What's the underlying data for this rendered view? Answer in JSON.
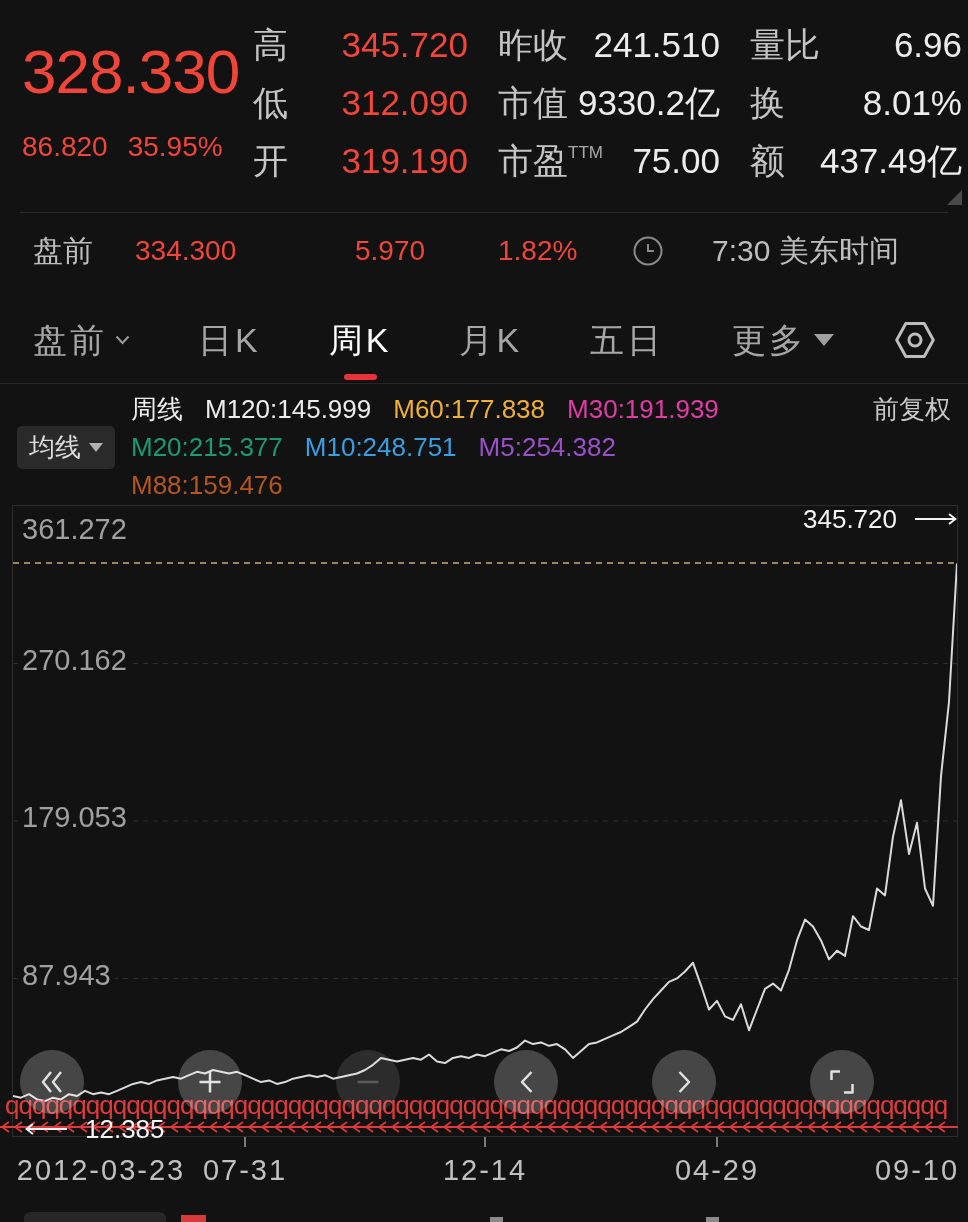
{
  "quote": {
    "price": "328.330",
    "change": "86.820",
    "change_pct": "35.95%",
    "up": true
  },
  "stats": [
    [
      {
        "label": "高",
        "value": "345.720",
        "up": true
      },
      {
        "label": "低",
        "value": "312.090",
        "up": true
      },
      {
        "label": "开",
        "value": "319.190",
        "up": true
      }
    ],
    [
      {
        "label": "昨收",
        "value": "241.510",
        "up": false
      },
      {
        "label": "市值",
        "value": "9330.2亿",
        "up": false
      },
      {
        "label": "市盈$^{TTM}$",
        "value": "75.00",
        "up": false
      }
    ],
    [
      {
        "label": "量比",
        "value": "6.96",
        "up": false
      },
      {
        "label": "换",
        "value": "8.01%",
        "up": false
      },
      {
        "label": "额",
        "value": "437.49亿",
        "up": false
      }
    ]
  ],
  "premarket": {
    "label": "盘前",
    "price": "334.300",
    "change": "5.970",
    "change_pct": "1.82%",
    "up": true,
    "time": "7:30 美东时间"
  },
  "tabs": [
    {
      "label": "盘前",
      "kind": "chevron",
      "selected": false
    },
    {
      "label": "日K",
      "kind": "plain",
      "selected": false
    },
    {
      "label": "周K",
      "kind": "plain",
      "selected": true
    },
    {
      "label": "月K",
      "kind": "plain",
      "selected": false
    },
    {
      "label": "五日",
      "kind": "plain",
      "selected": false
    },
    {
      "label": "更多",
      "kind": "triangle",
      "selected": false
    }
  ],
  "legend": {
    "dropdown": "均线",
    "adjustment": "前复权",
    "rows": [
      [
        {
          "kind": "title",
          "text": "周线"
        },
        {
          "kind": "ma",
          "text": "M120:145.999",
          "color": "#ececec"
        },
        {
          "kind": "ma",
          "text": "M60:177.838",
          "color": "#f0b034"
        },
        {
          "kind": "ma",
          "text": "M30:191.939",
          "color": "#e03ca4"
        }
      ],
      [
        {
          "kind": "ma",
          "text": "M20:215.377",
          "color": "#1c9a70"
        },
        {
          "kind": "ma",
          "text": "M10:248.751",
          "color": "#3a9ee2"
        },
        {
          "kind": "ma",
          "text": "M5:254.382",
          "color": "#9a50c8"
        }
      ],
      [
        {
          "kind": "ma",
          "text": "M88:159.476",
          "color": "#b4561e"
        }
      ]
    ]
  },
  "chart": {
    "chart_data": {
      "type": "line",
      "categories": [
        null,
        null,
        null,
        null,
        null,
        null,
        null,
        null,
        null,
        null,
        null,
        "2012-03-23",
        null,
        null,
        null,
        null,
        null,
        null,
        null,
        null,
        null,
        null,
        null,
        null,
        null,
        null,
        null,
        null,
        null,
        "07-31",
        null,
        null,
        null,
        null,
        null,
        null,
        null,
        null,
        null,
        null,
        null,
        null,
        null,
        null,
        null,
        null,
        null,
        null,
        null,
        null,
        null,
        null,
        null,
        null,
        null,
        null,
        null,
        null,
        null,
        "12-14",
        null,
        null,
        null,
        null,
        null,
        null,
        null,
        null,
        null,
        null,
        null,
        null,
        null,
        null,
        null,
        null,
        null,
        null,
        null,
        null,
        null,
        null,
        null,
        null,
        null,
        null,
        null,
        null,
        "04-29",
        null,
        null,
        null,
        null,
        null,
        null,
        null,
        null,
        null,
        null,
        null,
        null,
        null,
        null,
        null,
        null,
        null,
        null,
        null,
        null,
        null,
        null,
        null,
        null,
        "09-10",
        null,
        null,
        null,
        null,
        null
      ],
      "series": [
        {
          "color": "#dadada",
          "values": [
            20,
            19,
            21,
            18,
            17,
            19,
            18,
            21,
            20,
            23,
            21,
            22,
            21,
            23,
            25,
            27,
            28,
            27,
            29,
            30,
            31,
            30,
            32,
            34,
            33,
            35,
            34,
            33,
            34,
            32,
            30,
            28,
            29,
            27,
            28,
            30,
            31,
            32,
            31,
            32,
            30,
            31,
            32,
            33,
            35,
            38,
            42,
            41,
            40,
            41,
            42,
            41,
            44,
            40,
            39,
            42,
            43,
            42,
            44,
            43,
            45,
            47,
            46,
            48,
            52,
            50,
            51,
            49,
            50,
            47,
            42,
            46,
            50,
            51,
            53,
            55,
            57,
            60,
            63,
            70,
            76,
            81,
            86,
            88,
            92,
            97,
            84,
            70,
            75,
            66,
            64,
            73,
            58,
            70,
            82,
            85,
            81,
            93,
            110,
            122,
            118,
            110,
            99,
            104,
            101,
            124,
            118,
            116,
            140,
            136,
            170,
            191,
            160,
            178,
            140,
            130,
            205,
            248,
            328
          ]
        }
      ],
      "ylim": [
        -3.166,
        361.272
      ],
      "yticks": [
        361.272,
        270.162,
        179.053,
        87.943
      ],
      "grid": true,
      "ref_lines": [
        {
          "axis": "y",
          "value": 328.3
        }
      ],
      "annotations": [
        "345.720",
        "12.385"
      ]
    },
    "glyph_row": "qqqqqqqqqqqqqqqqqqqqqqqqqqqqqqqqqqqqqqqqqqqqqqqqqqqqqqqqqqqqqqqqqqqqqq",
    "controls": [
      {
        "kind": "rewind",
        "disabled": false
      },
      {
        "kind": "zoom_in",
        "disabled": false
      },
      {
        "kind": "zoom_out",
        "disabled": true
      },
      {
        "kind": "previous",
        "disabled": false
      },
      {
        "kind": "next",
        "disabled": false
      },
      {
        "kind": "fullscreen",
        "disabled": false
      }
    ]
  }
}
